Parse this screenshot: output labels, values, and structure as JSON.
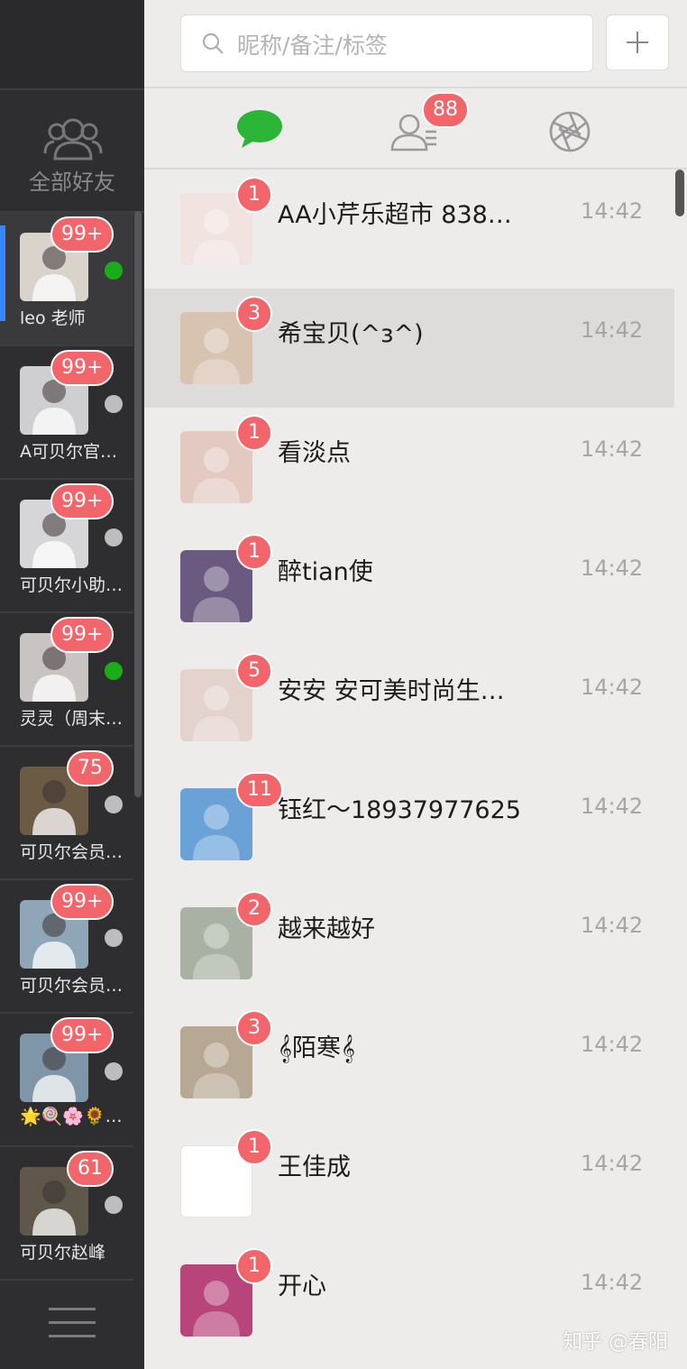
{
  "sidebar": {
    "all_friends_label": "全部好友",
    "accounts": [
      {
        "name": "leo 老师",
        "badge": "99+",
        "online": true,
        "active": true,
        "avatar_color": "#d9d3cc"
      },
      {
        "name": "A可贝尔官…",
        "badge": "99+",
        "online": false,
        "active": false,
        "avatar_color": "#cfcfd2"
      },
      {
        "name": "可贝尔小助…",
        "badge": "99+",
        "online": false,
        "active": false,
        "avatar_color": "#d6d6d8"
      },
      {
        "name": "灵灵（周末…",
        "badge": "99+",
        "online": true,
        "active": false,
        "avatar_color": "#c9c4c2"
      },
      {
        "name": "可贝尔会员…",
        "badge": "75",
        "online": false,
        "active": false,
        "avatar_color": "#6b5a44"
      },
      {
        "name": "可贝尔会员…",
        "badge": "99+",
        "online": false,
        "active": false,
        "avatar_color": "#8fa6b8"
      },
      {
        "name": "🌟🍭🌸🌻…",
        "badge": "99+",
        "online": false,
        "active": false,
        "avatar_color": "#7f95a8"
      },
      {
        "name": "可贝尔赵峰",
        "badge": "61",
        "online": false,
        "active": false,
        "avatar_color": "#5e574a"
      }
    ]
  },
  "search": {
    "placeholder": "昵称/备注/标签"
  },
  "tabs": {
    "contacts_badge": "88"
  },
  "colors": {
    "accent": "#3a86ff",
    "badge": "#f2656a",
    "online": "#1aad19",
    "offline": "#bdbdbd",
    "chat_tab": "#2bb537"
  },
  "chats": [
    {
      "name": "AA小芹乐超市 838…",
      "time": "14:42",
      "badge": "1",
      "avatar_color": "#f1e3e0"
    },
    {
      "name": "希宝贝(^з^)",
      "time": "14:42",
      "badge": "3",
      "avatar_color": "#d8c2b0",
      "highlighted": true
    },
    {
      "name": "看淡点",
      "time": "14:42",
      "badge": "1",
      "avatar_color": "#e3c9c0"
    },
    {
      "name": "醉tian使",
      "time": "14:42",
      "badge": "1",
      "avatar_color": "#6a5a80"
    },
    {
      "name": "安安 安可美时尚生…",
      "time": "14:42",
      "badge": "5",
      "avatar_color": "#e4d2cc"
    },
    {
      "name": "钰红～18937977625",
      "time": "14:42",
      "badge": "11",
      "avatar_color": "#6aa2d8"
    },
    {
      "name": "越来越好",
      "time": "14:42",
      "badge": "2",
      "avatar_color": "#a9b1a4"
    },
    {
      "name": "𝄞陌寒𝄞",
      "time": "14:42",
      "badge": "3",
      "avatar_color": "#b7a893"
    },
    {
      "name": "王佳成",
      "time": "14:42",
      "badge": "1",
      "avatar_color": "#ffffff"
    },
    {
      "name": "开心",
      "time": "14:42",
      "badge": "1",
      "avatar_color": "#b8457a"
    }
  ],
  "watermark": "知乎 @春阳"
}
